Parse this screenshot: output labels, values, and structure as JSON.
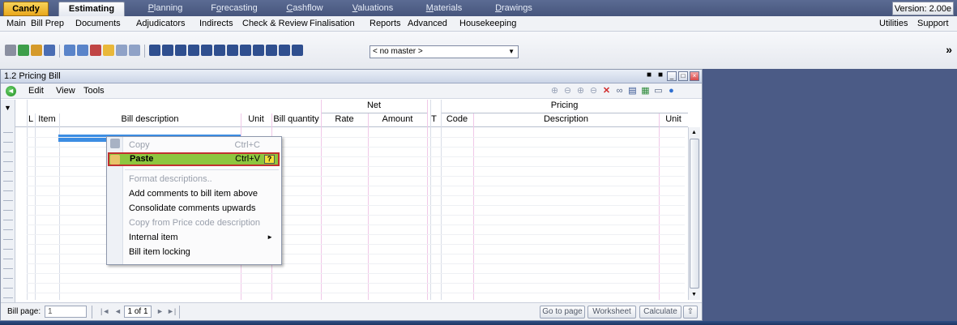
{
  "top_tabs": [
    {
      "label": "Candy"
    },
    {
      "label": "Estimating"
    },
    {
      "label": "Planning",
      "u": "P",
      "rest": "lanning"
    },
    {
      "label": "Forecasting",
      "pre": "F",
      "u": "o",
      "rest": "recasting"
    },
    {
      "label": "Cashflow",
      "u": "C",
      "rest": "ashflow"
    },
    {
      "label": "Valuations",
      "u": "V",
      "rest": "aluations"
    },
    {
      "label": "Materials",
      "u": "M",
      "rest": "aterials"
    },
    {
      "label": "Drawings",
      "u": "D",
      "rest": "rawings"
    }
  ],
  "version": "Version: 2.00e",
  "menu": [
    "Main",
    "Bill Prep",
    "Documents",
    "Adjudicators",
    "Indirects",
    "Check & Review",
    "Finalisation",
    "Reports",
    "Advanced",
    "Housekeeping"
  ],
  "menu_right": [
    "Utilities",
    "Support"
  ],
  "toolbar": {
    "master_select": "< no master >",
    "more": "»"
  },
  "window": {
    "title": "1.2 Pricing Bill",
    "menu": [
      "Edit",
      "View",
      "Tools"
    ]
  },
  "grid": {
    "group_net": "Net",
    "group_pricing": "Pricing",
    "columns": {
      "l": "L",
      "item": "Item",
      "bill_description": "Bill description",
      "unit": "Unit",
      "bill_quantity": "Bill quantity",
      "rate": "Rate",
      "amount": "Amount",
      "t": "T",
      "code": "Code",
      "description": "Description",
      "unit2": "Unit"
    }
  },
  "context_menu": {
    "copy": {
      "label": "Copy",
      "shortcut": "Ctrl+C"
    },
    "paste": {
      "label": "Paste",
      "shortcut": "Ctrl+V",
      "help": "?"
    },
    "format_descriptions": "Format descriptions..",
    "add_comments": "Add comments to bill item above",
    "consolidate_comments": "Consolidate comments upwards",
    "copy_from_price_code": "Copy from Price code description",
    "internal_item": "Internal item",
    "bill_item_locking": "Bill item locking"
  },
  "status": {
    "bill_page_label": "Bill page:",
    "bill_page_value": "1",
    "page_of": "1 of 1",
    "go_to_page": "Go to page",
    "worksheet": "Worksheet",
    "calculate": "Calculate"
  },
  "colors": {
    "accent_green": "#8dc63f",
    "highlight_red": "#c23030",
    "selection_blue": "#3c8de3",
    "net_divider_pink": "#f0c8e8"
  }
}
